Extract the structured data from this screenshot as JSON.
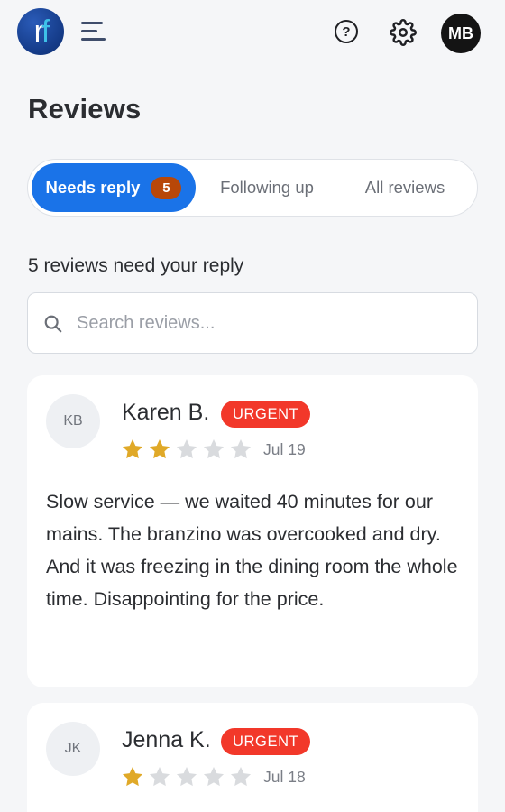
{
  "header": {
    "logo_left": "r",
    "logo_right": "f",
    "help_symbol": "?",
    "user_initials": "MB"
  },
  "page": {
    "title": "Reviews"
  },
  "tabs": [
    {
      "label": "Needs reply",
      "badge": "5",
      "active": true
    },
    {
      "label": "Following up",
      "active": false
    },
    {
      "label": "All reviews",
      "active": false
    }
  ],
  "summary": "5 reviews need your reply",
  "search": {
    "placeholder": "Search reviews..."
  },
  "reviews": [
    {
      "initials": "KB",
      "name": "Karen B.",
      "tag": "URGENT",
      "rating": 2,
      "max_rating": 5,
      "date": "Jul 19",
      "text": "Slow service — we waited 40 minutes for our mains. The branzino was overcooked and dry. And it was freezing in the dining room the whole time. Disappointing for the price."
    },
    {
      "initials": "JK",
      "name": "Jenna K.",
      "tag": "URGENT",
      "rating": 1,
      "max_rating": 5,
      "date": "Jul 18",
      "text": ""
    }
  ],
  "colors": {
    "accent": "#1a73e8",
    "badge": "#b84708",
    "urgent": "#f2382a",
    "star_filled": "#e0a928",
    "star_empty": "#d9dbde"
  },
  "icons": {
    "menu": "hamburger-menu-icon",
    "help": "help-circle-icon",
    "settings": "gear-icon",
    "search": "search-icon",
    "star": "star-icon"
  }
}
